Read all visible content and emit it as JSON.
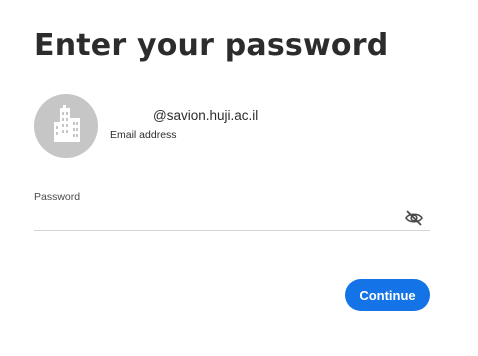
{
  "page": {
    "title": "Enter your password"
  },
  "account": {
    "email_value": "@savion.huji.ac.il",
    "email_label": "Email address",
    "avatar_icon": "building-icon"
  },
  "password": {
    "label": "Password",
    "value": "",
    "toggle_icon": "eye-hidden-icon"
  },
  "actions": {
    "continue_label": "Continue"
  },
  "colors": {
    "accent": "#1473e6",
    "avatar_bg": "#c6c6c6",
    "text": "#2c2c2c"
  }
}
